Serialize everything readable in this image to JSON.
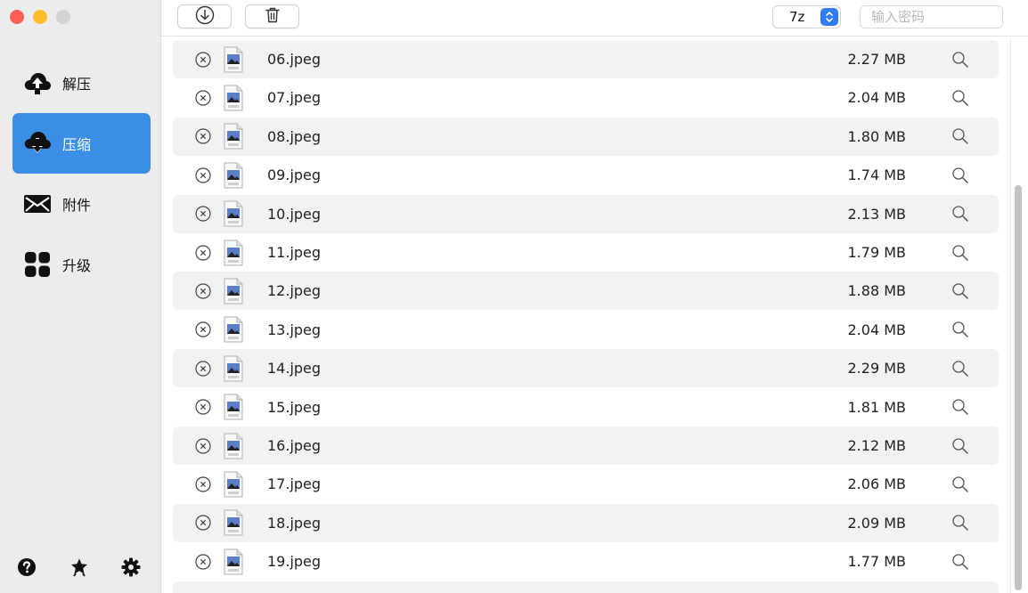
{
  "sidebar": {
    "items": [
      {
        "label": "解压",
        "icon": "cloud-upload-icon",
        "active": false
      },
      {
        "label": "压缩",
        "icon": "cloud-download-icon",
        "active": true
      },
      {
        "label": "附件",
        "icon": "envelope-icon",
        "active": false
      },
      {
        "label": "升级",
        "icon": "grid-icon",
        "active": false
      }
    ],
    "bottom_icons": [
      "help-icon",
      "star-badge-icon",
      "settings-icon"
    ]
  },
  "toolbar": {
    "download_icon": "download-icon",
    "delete_icon": "trash-icon",
    "format_value": "7z",
    "password_placeholder": "输入密码"
  },
  "files": [
    {
      "name": "06.jpeg",
      "size": "2.27 MB"
    },
    {
      "name": "07.jpeg",
      "size": "2.04 MB"
    },
    {
      "name": "08.jpeg",
      "size": "1.80 MB"
    },
    {
      "name": "09.jpeg",
      "size": "1.74 MB"
    },
    {
      "name": "10.jpeg",
      "size": "2.13 MB"
    },
    {
      "name": "11.jpeg",
      "size": "1.79 MB"
    },
    {
      "name": "12.jpeg",
      "size": "1.88 MB"
    },
    {
      "name": "13.jpeg",
      "size": "2.04 MB"
    },
    {
      "name": "14.jpeg",
      "size": "2.29 MB"
    },
    {
      "name": "15.jpeg",
      "size": "1.81 MB"
    },
    {
      "name": "16.jpeg",
      "size": "2.12 MB"
    },
    {
      "name": "17.jpeg",
      "size": "2.06 MB"
    },
    {
      "name": "18.jpeg",
      "size": "2.09 MB"
    },
    {
      "name": "19.jpeg",
      "size": "1.77 MB"
    }
  ],
  "colors": {
    "accent": "#3a8ee6",
    "stripe": "#f1f2f3",
    "sidebar_bg": "#ececec"
  }
}
